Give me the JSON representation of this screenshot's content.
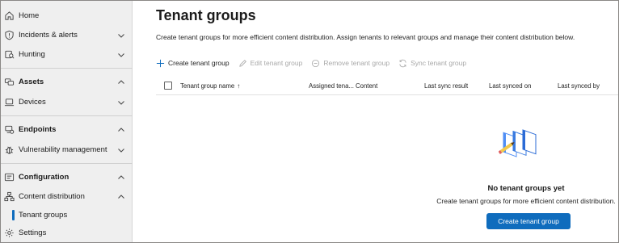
{
  "sidebar": {
    "items": [
      {
        "label": "Home",
        "icon": "home-icon"
      },
      {
        "label": "Incidents & alerts",
        "icon": "shield-icon",
        "chevron": "down"
      },
      {
        "label": "Hunting",
        "icon": "hunting-icon",
        "chevron": "down"
      },
      {
        "label": "Assets",
        "icon": "assets-icon",
        "chevron": "up",
        "section": true
      },
      {
        "label": "Devices",
        "icon": "laptop-icon",
        "chevron": "down"
      },
      {
        "label": "Endpoints",
        "icon": "endpoints-icon",
        "chevron": "up",
        "section": true
      },
      {
        "label": "Vulnerability management",
        "icon": "bug-icon",
        "chevron": "down"
      },
      {
        "label": "Configuration",
        "icon": "configuration-icon",
        "chevron": "up",
        "section": true
      },
      {
        "label": "Content distribution",
        "icon": "hierarchy-icon",
        "chevron": "up"
      },
      {
        "label": "Tenant groups",
        "selected": true
      },
      {
        "label": "Settings",
        "icon": "gear-icon"
      }
    ]
  },
  "main": {
    "title": "Tenant groups",
    "description": "Create tenant groups for more efficient content distribution. Assign tenants to relevant groups and manage their content distribution below.",
    "toolbar": {
      "create": "Create tenant group",
      "edit": "Edit tenant group",
      "remove": "Remove tenant group",
      "sync": "Sync tenant group"
    },
    "table": {
      "columns": [
        "Tenant group name",
        "Assigned tena...",
        "Content",
        "Last sync result",
        "Last synced on",
        "Last synced by"
      ],
      "sort_indicator": "↑"
    },
    "empty_state": {
      "title": "No tenant groups yet",
      "description": "Create tenant groups for more efficient content distribution.",
      "button": "Create tenant group"
    }
  },
  "colors": {
    "accent": "#0f6cbd",
    "sidebar_bg": "#efefef",
    "disabled_text": "#a8a8a8"
  }
}
